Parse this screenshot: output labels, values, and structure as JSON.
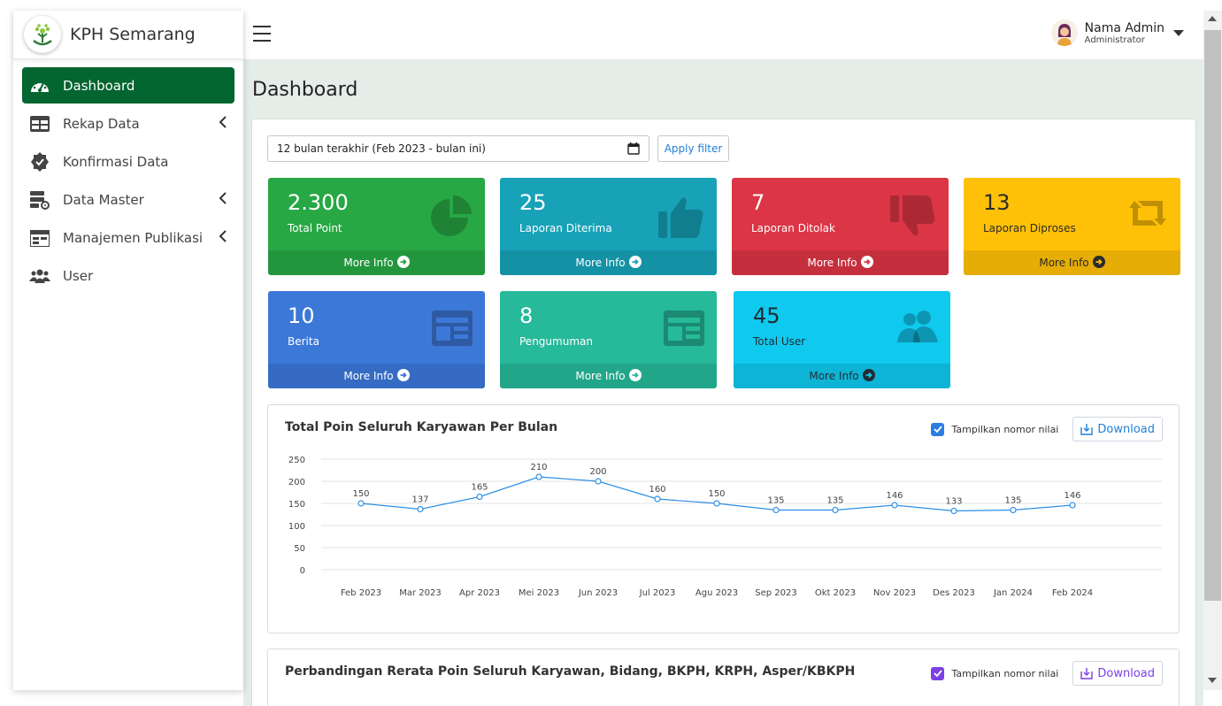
{
  "brand": {
    "name": "KPH Semarang"
  },
  "sidebar": {
    "items": [
      {
        "label": "Dashboard",
        "icon": "tachometer-icon",
        "active": true
      },
      {
        "label": "Rekap Data",
        "icon": "table-icon",
        "has_submenu": true
      },
      {
        "label": "Konfirmasi Data",
        "icon": "badge-check-icon"
      },
      {
        "label": "Data Master",
        "icon": "server-cog-icon",
        "has_submenu": true
      },
      {
        "label": "Manajemen Publikasi",
        "icon": "calendar-table-icon",
        "has_submenu": true
      },
      {
        "label": "User",
        "icon": "users-icon"
      }
    ]
  },
  "user": {
    "name": "Nama Admin",
    "role": "Administrator"
  },
  "page": {
    "title": "Dashboard"
  },
  "filter": {
    "value": "12 bulan terakhir (Feb 2023 - bulan ini)",
    "apply_label": "Apply filter"
  },
  "colors": {
    "green": "#28a745",
    "teal": "#17a2b8",
    "red": "#dc3545",
    "yellow": "#ffc107",
    "blue": "#3c78d8",
    "mint": "#26b99a",
    "cyan": "#10c9ef",
    "sidebar_active": "#03652f"
  },
  "stat_boxes": [
    {
      "value": "2.300",
      "label": "Total Point",
      "more": "More Info",
      "icon": "pie-chart-icon"
    },
    {
      "value": "25",
      "label": "Laporan Diterima",
      "more": "More Info",
      "icon": "thumbs-up-icon"
    },
    {
      "value": "7",
      "label": "Laporan Ditolak",
      "more": "More Info",
      "icon": "thumbs-down-icon"
    },
    {
      "value": "13",
      "label": "Laporan Diproses",
      "more": "More Info",
      "icon": "retweet-icon"
    },
    {
      "value": "10",
      "label": "Berita",
      "more": "More Info",
      "icon": "newspaper-icon"
    },
    {
      "value": "8",
      "label": "Pengumuman",
      "more": "More Info",
      "icon": "newspaper-icon"
    },
    {
      "value": "45",
      "label": "Total User",
      "more": "More Info",
      "icon": "users-icon"
    }
  ],
  "chart1": {
    "title": "Total Poin Seluruh Karyawan Per Bulan",
    "checkbox_label": "Tampilkan nomor nilai",
    "download_label": "Download"
  },
  "chart2": {
    "title": "Perbandingan Rerata Poin Seluruh Karyawan, Bidang, BKPH, KRPH, Asper/KBKPH",
    "checkbox_label": "Tampilkan nomor nilai",
    "download_label": "Download"
  },
  "chart_data": {
    "type": "line",
    "title": "Total Poin Seluruh Karyawan Per Bulan",
    "xlabel": "",
    "ylabel": "",
    "ylim": [
      0,
      250
    ],
    "yticks": [
      0,
      50,
      100,
      150,
      200,
      250
    ],
    "categories": [
      "Feb 2023",
      "Mar 2023",
      "Apr 2023",
      "Mei 2023",
      "Jun 2023",
      "Jul 2023",
      "Agu 2023",
      "Sep 2023",
      "Okt 2023",
      "Nov 2023",
      "Des 2023",
      "Jan 2024",
      "Feb 2024"
    ],
    "series": [
      {
        "values": [
          150,
          137,
          165,
          210,
          200,
          160,
          150,
          135,
          135,
          146,
          133,
          135,
          146
        ],
        "color": "#2d8fe6"
      }
    ],
    "data_labels": true,
    "grid": true
  }
}
